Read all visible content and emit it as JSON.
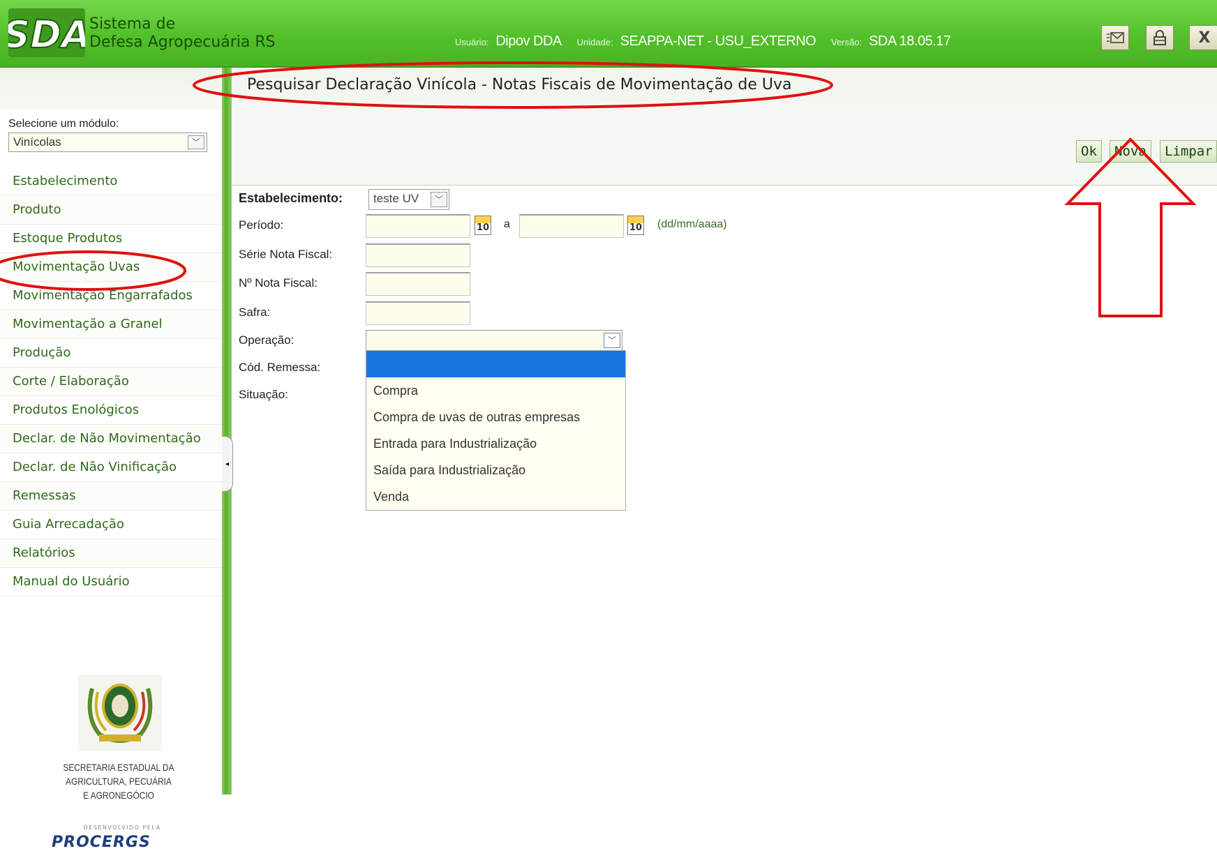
{
  "header": {
    "system_name_line1": "Sistema de",
    "system_name_line2": "Defesa Agropecuária RS",
    "user_label": "Usuário:",
    "user_value": "Dipov DDA",
    "unit_label": "Unidade:",
    "unit_value": "SEAPPA-NET - USU_EXTERNO",
    "version_label": "Versão:",
    "version_value": "SDA 18.05.17",
    "close_label": "X",
    "logo_text": "SDA"
  },
  "sidebar": {
    "module_label": "Selecione um módulo:",
    "module_selected": "Vinícolas",
    "items": [
      {
        "label": "Estabelecimento"
      },
      {
        "label": "Produto"
      },
      {
        "label": "Estoque Produtos"
      },
      {
        "label": "Movimentação Uvas"
      },
      {
        "label": "Movimentação Engarrafados"
      },
      {
        "label": "Movimentação a Granel"
      },
      {
        "label": "Produção"
      },
      {
        "label": "Corte / Elaboração"
      },
      {
        "label": "Produtos Enológicos"
      },
      {
        "label": "Declar. de Não Movimentação"
      },
      {
        "label": "Declar. de Não Vinificação"
      },
      {
        "label": "Remessas"
      },
      {
        "label": "Guia Arrecadação"
      },
      {
        "label": "Relatórios"
      },
      {
        "label": "Manual do Usuário"
      }
    ],
    "secretaria_line1": "Secretaria Estadual da",
    "secretaria_line2": "Agricultura, Pecuária",
    "secretaria_line3": "e Agronegócio",
    "developed_by": "DESENVOLVIDO PELA",
    "procergs": "PROCERGS"
  },
  "main": {
    "title": "Pesquisar Declaração Vinícola - Notas Fiscais de Movimentação de Uva",
    "toolbar": {
      "ok_label": "Ok",
      "nova_label": "Nova",
      "limpar_label": "Limpar"
    },
    "form": {
      "estabelecimento_label": "Estabelecimento:",
      "estabelecimento_value": "teste UV",
      "periodo_label": "Período:",
      "periodo_start": "",
      "periodo_sep": "a",
      "periodo_end": "",
      "periodo_format": "(dd/mm/aaaa)",
      "calendar_day": "10",
      "serie_label": "Série Nota Fiscal:",
      "serie_value": "",
      "nota_label": "Nº Nota Fiscal:",
      "nota_value": "",
      "safra_label": "Safra:",
      "safra_value": "",
      "operacao_label": "Operação:",
      "operacao_value": "",
      "cod_remessa_label": "Cód. Remessa:",
      "situacao_label": "Situação:"
    },
    "operacao_options": [
      {
        "label": ""
      },
      {
        "label": "Compra"
      },
      {
        "label": "Compra de uvas de outras empresas"
      },
      {
        "label": "Entrada para Industrialização"
      },
      {
        "label": "Saída para Industrialização"
      },
      {
        "label": "Venda"
      }
    ]
  },
  "colors": {
    "header_green": "#52c02a",
    "menu_text": "#2f6a1a",
    "annotation_red": "#e01010",
    "dropdown_highlight": "#1a74e0"
  },
  "icons": {
    "email": "email-icon",
    "lock": "lock-icon",
    "close": "close-icon",
    "calendar": "calendar-icon",
    "chevron": "chevron-down-icon"
  }
}
